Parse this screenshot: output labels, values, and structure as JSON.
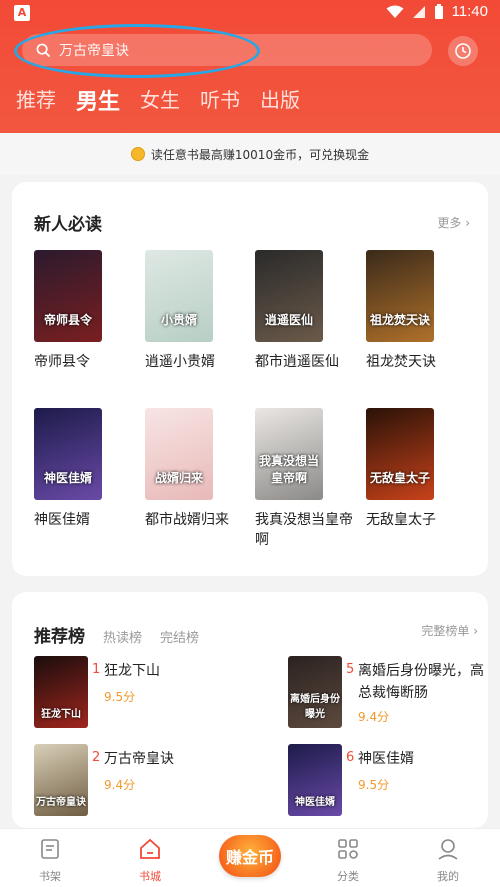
{
  "status": {
    "time": "11:40",
    "left_icon": "A"
  },
  "search": {
    "placeholder": "万古帝皇诀"
  },
  "tabs": [
    "推荐",
    "男生",
    "女生",
    "听书",
    "出版"
  ],
  "active_tab": 1,
  "banner": {
    "text": "读任意书最高赚10010金币，可兑换现金"
  },
  "new_reader": {
    "title": "新人必读",
    "more": "更多",
    "books": [
      {
        "title": "帝师县令",
        "cover_text": "帝师县令",
        "colors": [
          "#2b1a2e",
          "#7a1f1f"
        ]
      },
      {
        "title": "逍遥小贵婿",
        "cover_text": "小贵婿",
        "colors": [
          "#dfe8e4",
          "#b7cfc4"
        ]
      },
      {
        "title": "都市逍遥医仙",
        "cover_text": "逍遥医仙",
        "colors": [
          "#2a2a2a",
          "#6b5a4a"
        ]
      },
      {
        "title": "祖龙焚天诀",
        "cover_text": "祖龙焚天诀",
        "colors": [
          "#3a2a1a",
          "#b0712a"
        ]
      },
      {
        "title": "神医佳婿",
        "cover_text": "神医佳婿",
        "colors": [
          "#1d1b4a",
          "#6a4aa8"
        ]
      },
      {
        "title": "都市战婿归来",
        "cover_text": "战婿归来",
        "colors": [
          "#f7e5e4",
          "#e8b9b8"
        ]
      },
      {
        "title": "我真没想当皇帝啊",
        "cover_text": "我真没想当皇帝啊",
        "colors": [
          "#eae7e4",
          "#8c8a88"
        ]
      },
      {
        "title": "无敌皇太子",
        "cover_text": "无敌皇太子",
        "colors": [
          "#2a1208",
          "#c8421a"
        ]
      }
    ]
  },
  "ranking": {
    "tabs": [
      "推荐榜",
      "热读榜",
      "完结榜"
    ],
    "more": "完整榜单",
    "items": [
      {
        "rank": "1",
        "title": "狂龙下山",
        "score": "9.5分",
        "cover_text": "狂龙下山",
        "colors": [
          "#1a0d0d",
          "#a0261d"
        ]
      },
      {
        "rank": "2",
        "title": "万古帝皇诀",
        "score": "9.4分",
        "cover_text": "万古帝皇诀",
        "colors": [
          "#d9cfb8",
          "#6f5d42"
        ]
      },
      {
        "rank": "5",
        "title": "离婚后身份曝光，高",
        "title2": "总裁悔断肠",
        "score": "9.4分",
        "cover_text": "离婚后身份曝光",
        "colors": [
          "#2a2220",
          "#5d4a3e"
        ]
      },
      {
        "rank": "6",
        "title": "神医佳婿",
        "score": "9.5分",
        "cover_text": "神医佳婿",
        "colors": [
          "#1d1b4a",
          "#6a4aa8"
        ]
      }
    ]
  },
  "bottom_nav": {
    "items": [
      "书架",
      "书城",
      "分类",
      "我的"
    ],
    "active": 1,
    "earn_label": "赚金币"
  },
  "colors": {
    "brand": "#f24a37",
    "score": "#f39a2b",
    "highlight": "#27a7e6"
  }
}
